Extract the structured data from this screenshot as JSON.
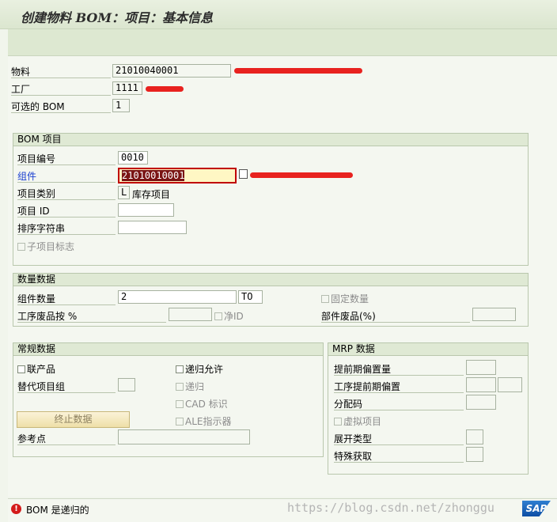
{
  "title": "创建物料 BOM：项目：基本信息",
  "header": {
    "material_label": "物料",
    "material_value": "21010040001",
    "plant_label": "工厂",
    "plant_value": "1111",
    "alt_bom_label": "可选的 BOM",
    "alt_bom_value": "1"
  },
  "bom_item": {
    "title": "BOM 项目",
    "item_no_label": "项目编号",
    "item_no_value": "0010",
    "component_label": "组件",
    "component_value": "21010010001",
    "item_cat_label": "项目类别",
    "item_cat_value": "L",
    "item_cat_desc": "库存项目",
    "item_id_label": "项目 ID",
    "item_id_value": "",
    "sort_label": "排序字符串",
    "sort_value": "",
    "subitem_label": "子项目标志"
  },
  "qty": {
    "title": "数量数据",
    "comp_qty_label": "组件数量",
    "comp_qty_value": "2",
    "unit_value": "TO",
    "fixed_qty_label": "固定数量",
    "op_scrap_label": "工序废品按 %",
    "op_scrap_value": "",
    "net_id_label": "净ID",
    "comp_scrap_label": "部件废品(%)",
    "comp_scrap_value": ""
  },
  "general": {
    "title": "常规数据",
    "coproduct_label": "联产品",
    "recursive_allowed_label": "递归允许",
    "alt_group_label": "替代项目组",
    "alt_group_value": "",
    "recursive_label": "递归",
    "cad_label": "CAD 标识",
    "ale_label": "ALE指示器",
    "end_data_button": "终止数据",
    "ref_point_label": "参考点",
    "ref_point_value": ""
  },
  "mrp": {
    "title": "MRP 数据",
    "lead_offset_label": "提前期偏置量",
    "op_lead_offset_label": "工序提前期偏置",
    "dist_key_label": "分配码",
    "phantom_label": "虚拟项目",
    "explosion_label": "展开类型",
    "special_proc_label": "特殊获取"
  },
  "status": {
    "message": "BOM 是递归的"
  },
  "watermark": "https://blog.csdn.net/zhonggu",
  "logo": "SAP"
}
